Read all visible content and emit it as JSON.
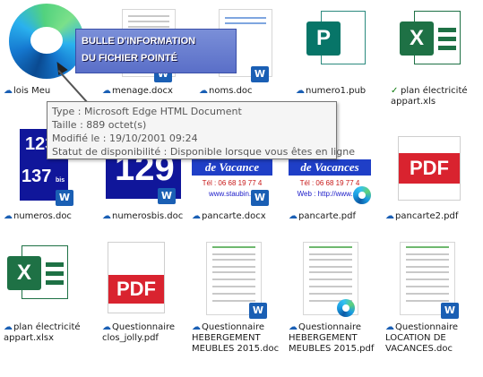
{
  "colors": {
    "cloud": "#1a5fb4",
    "ok": "#0f7b0f",
    "word": "#1a5fb4",
    "excel": "#1e7145",
    "pdf": "#d9232f",
    "publisher": "#077568"
  },
  "icons": {
    "cloud": "☁",
    "ok": "✓"
  },
  "files": [
    {
      "name": "lois Meu",
      "status": "cloud"
    },
    {
      "name": "menage.docx",
      "status": "cloud"
    },
    {
      "name": "noms.doc",
      "status": "cloud"
    },
    {
      "name": "numero1.pub",
      "status": "cloud"
    },
    {
      "name": "plan électricité appart.xls",
      "status": "ok"
    },
    {
      "name": "numeros.doc",
      "status": "cloud"
    },
    {
      "name": "numerosbis.doc",
      "status": "cloud"
    },
    {
      "name": "pancarte.docx",
      "status": "cloud"
    },
    {
      "name": "pancarte.pdf",
      "status": "cloud"
    },
    {
      "name": "pancarte2.pdf",
      "status": "cloud"
    },
    {
      "name": "plan électricité appart.xlsx",
      "status": "cloud"
    },
    {
      "name": "Questionnaire clos_jolly.pdf",
      "status": "cloud"
    },
    {
      "name": "Questionnaire HEBERGEMENT MEUBLES 2015.doc",
      "status": "cloud"
    },
    {
      "name": "Questionnaire HEBERGEMENT MEUBLES 2015.pdf",
      "status": "cloud"
    },
    {
      "name": "Questionnaire LOCATION DE VACANCES.doc",
      "status": "cloud"
    }
  ],
  "thumbs": {
    "numeros_top": "123",
    "numeros_bottom": "137",
    "numeros_bis": "bis",
    "numerosbis_big": "129",
    "pdf_text": "PDF",
    "word_badge": "W",
    "excel_letter": "X",
    "pub_letter": "P",
    "vac_heading": "de Vacance",
    "vac_heading2": "de Vacances",
    "vac_tel": "Tél : 06 68 19 77 4",
    "vac_tel2": "Tél : 06 68 19 77 4",
    "vac_url": "www.staubin.fr",
    "vac_url2": "Web : http://www.sta"
  },
  "balloon": {
    "line1": "BULLE D'INFORMATION",
    "line2": "DU FICHIER POINTÉ"
  },
  "tooltip": {
    "type": "Type : Microsoft Edge HTML Document",
    "size": "Taille : 889 octet(s)",
    "modified": "Modifié le : 19/10/2001 09:24",
    "availability": "Statut de disponibilité : Disponible lorsque vous êtes en ligne"
  }
}
